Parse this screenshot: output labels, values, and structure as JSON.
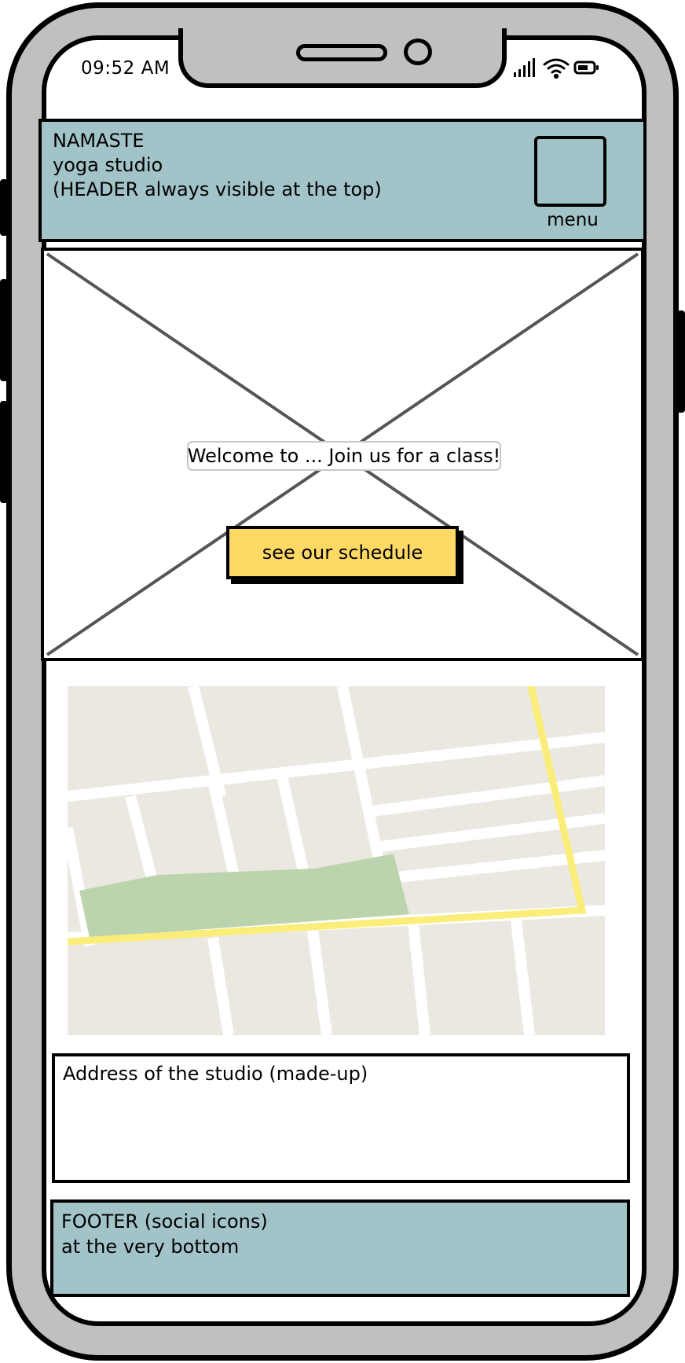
{
  "status_bar": {
    "time": "09:52 AM"
  },
  "header": {
    "lines": [
      "NAMASTE",
      "yoga studio",
      "(HEADER always visible at the top)"
    ],
    "menu_label": "menu"
  },
  "hero": {
    "welcome_text": "Welcome to ... Join us for a class!",
    "schedule_button": "see our schedule"
  },
  "address": {
    "text": "Address of the studio (made-up)"
  },
  "footer": {
    "lines": [
      "FOOTER (social icons)",
      "at the very bottom"
    ]
  },
  "colors": {
    "header_bg": "#a2c3c8",
    "button_yellow": "#ffd966",
    "map_block": "#ebe8e1",
    "map_park": "#bcd4ad",
    "map_highway": "#fbed7a"
  },
  "icons": [
    "cellular-signal-icon",
    "wifi-icon",
    "battery-icon",
    "menu-icon",
    "map-image"
  ]
}
